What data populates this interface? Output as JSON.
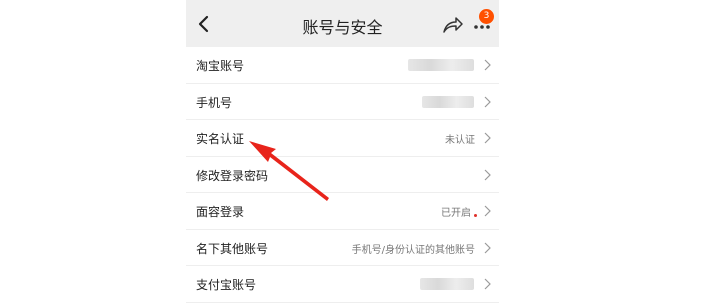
{
  "header": {
    "title": "账号与安全",
    "badge_count": "3",
    "icons": {
      "back": "back-chevron-icon",
      "share": "share-icon",
      "more": "more-dots-icon"
    }
  },
  "rows": [
    {
      "label": "淘宝账号",
      "value": "",
      "value_blurred": true
    },
    {
      "label": "手机号",
      "value": "",
      "value_blurred": true
    },
    {
      "label": "实名认证",
      "value": "未认证",
      "value_blurred": false
    },
    {
      "label": "修改登录密码",
      "value": "",
      "value_blurred": false
    },
    {
      "label": "面容登录",
      "value": "已开启",
      "value_blurred": false,
      "dot": true
    },
    {
      "label": "名下其他账号",
      "value": "手机号/身份认证的其他账号",
      "value_blurred": false
    },
    {
      "label": "支付宝账号",
      "value": "",
      "value_blurred": true
    }
  ],
  "colors": {
    "accent": "#ff5000",
    "annotation_arrow": "#e8241b",
    "background": "#efefef"
  }
}
